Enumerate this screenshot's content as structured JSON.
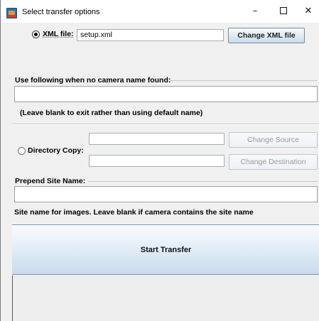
{
  "window": {
    "title": "Select transfer options",
    "minimize_glyph": "–",
    "close_glyph": "✕",
    "icon": "java-cup-icon"
  },
  "xml": {
    "radio_label": "XML file:",
    "selected": true,
    "value": "setup.xml",
    "change_button": "Change XML file"
  },
  "camera": {
    "label": "Use following when no camera name found:",
    "value": "",
    "hint": "(Leave blank to exit rather than using default name)"
  },
  "directory": {
    "radio_label": "Directory Copy:",
    "selected": false,
    "source_value": "",
    "destination_value": "",
    "change_source_button": "Change Source",
    "change_destination_button": "Change Destination"
  },
  "site": {
    "label": "Prepend Site Name:",
    "value": "",
    "hint": "Site name for images.  Leave blank if camera contains the site name"
  },
  "actions": {
    "start_button": "Start Transfer"
  }
}
